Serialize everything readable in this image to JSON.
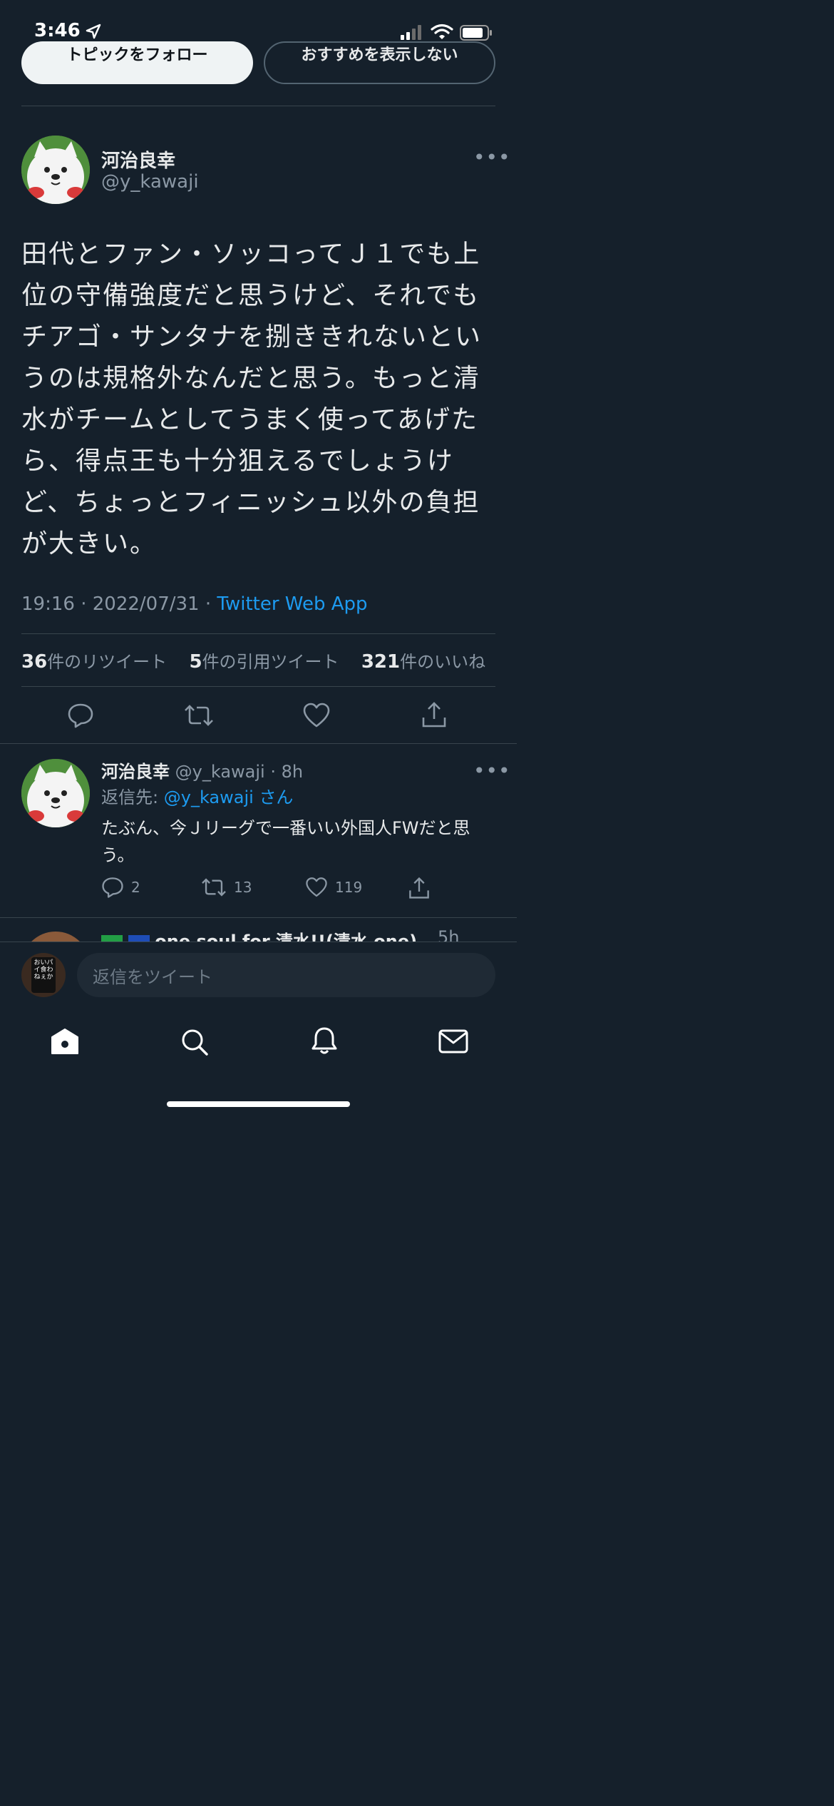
{
  "status_bar": {
    "time": "3:46"
  },
  "topic_buttons": {
    "follow": "トピックをフォロー",
    "hide": "おすすめを表示しない"
  },
  "tweet": {
    "name": "河治良幸",
    "handle": "@y_kawaji",
    "text": "田代とファン・ソッコってＪ１でも上位の守備強度だと思うけど、それでもチアゴ・サンタナを捌ききれないというのは規格外なんだと思う。もっと清水がチームとしてうまく使ってあげたら、得点王も十分狙えるでしょうけど、ちょっとフィニッシュ以外の負担が大きい。",
    "time": "19:16",
    "date": "2022/07/31",
    "source": "Twitter Web App",
    "retweets": "36",
    "retweets_label": "件のリツイート",
    "quotes": "5",
    "quotes_label": "件の引用ツイート",
    "likes": "321",
    "likes_label": "件のいいね"
  },
  "reply": {
    "name": "河治良幸",
    "handle": "@y_kawaji",
    "age": "8h",
    "reply_to_label": "返信先:",
    "reply_to_handle": "@y_kawaji",
    "reply_to_suffix": "さん",
    "text": "たぶん、今Ｊリーグで一番いい外国人FWだと思う。",
    "reply_count": "2",
    "retweet_count": "13",
    "like_count": "119"
  },
  "next_reply": {
    "name": "one soul for 清水!!(清水 one)",
    "age": "5h"
  },
  "composer": {
    "placeholder": "返信をツイート",
    "avatar_text": "おいパイ食わねぇか"
  },
  "nav": {
    "items": [
      "home",
      "search",
      "notifications",
      "messages"
    ]
  },
  "colors": {
    "background": "#15202b",
    "accent": "#1d9bf0",
    "muted": "#8b98a5",
    "divider": "#38444d"
  }
}
